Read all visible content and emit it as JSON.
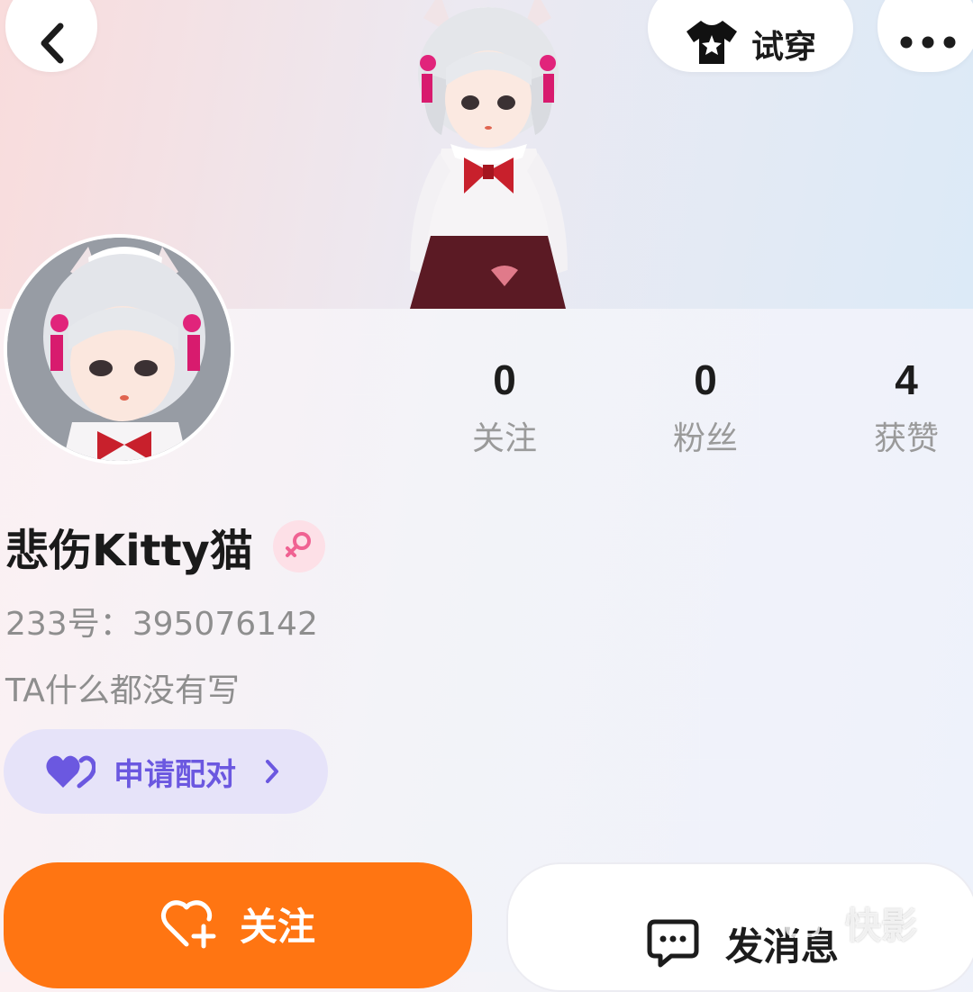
{
  "header": {
    "try_on_label": "试穿"
  },
  "stats": [
    {
      "value": "0",
      "label": "关注"
    },
    {
      "value": "0",
      "label": "粉丝"
    },
    {
      "value": "4",
      "label": "获赞"
    }
  ],
  "profile": {
    "name": "悲伤Kitty猫",
    "id_text": "233号：395076142",
    "bio": "TA什么都没有写",
    "gender": "female"
  },
  "actions": {
    "pair_label": "申请配对",
    "follow_label": "关注",
    "message_label": "发消息"
  },
  "watermark": {
    "text": "快影"
  },
  "colors": {
    "follow_bg": "#ff7512",
    "pair_bg": "#e6e3f9",
    "pair_text": "#6b58e0",
    "gender_bg": "#fde0e7",
    "gender_icon": "#f06292"
  }
}
